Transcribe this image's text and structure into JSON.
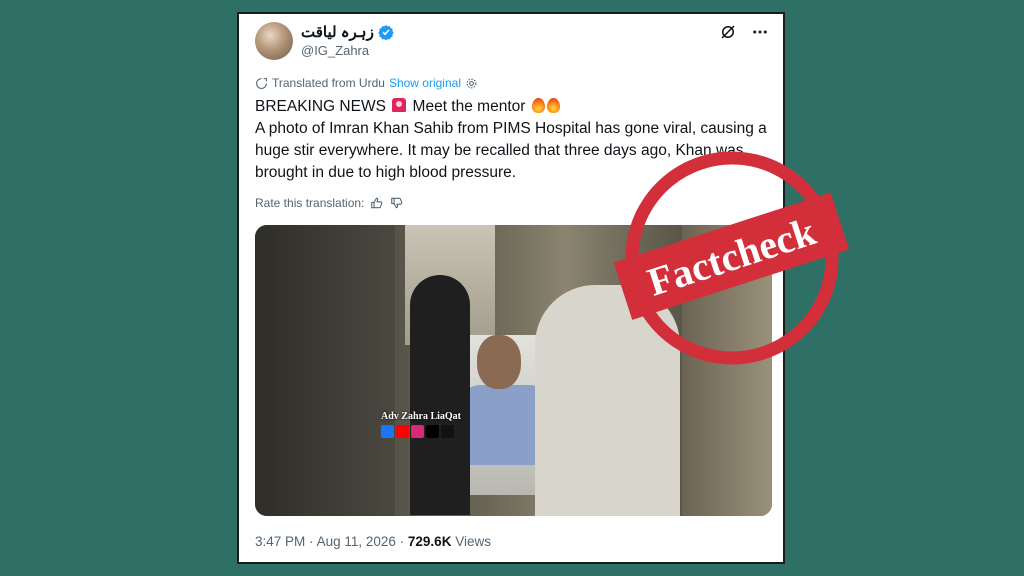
{
  "author": {
    "name": "زہرہ لیاقت",
    "handle": "@IG_Zahra"
  },
  "translation": {
    "note": "Translated from Urdu",
    "show_original": "Show original",
    "rate_label": "Rate this translation:"
  },
  "tweet": {
    "line1_a": "BREAKING NEWS",
    "line1_b": "Meet the mentor",
    "body": "A photo of Imran Khan Sahib from PIMS Hospital has gone viral, causing a huge stir everywhere. It may be recalled that three days ago, Khan was brought in due to high blood pressure."
  },
  "media": {
    "watermark": "Adv Zahra LiaQat"
  },
  "footer": {
    "time": "3:47 PM",
    "date": "Aug 11, 2026",
    "views_count": "729.6K",
    "views_label": "Views"
  },
  "stamp": {
    "text": "Factcheck"
  },
  "colors": {
    "background": "#2e7066",
    "link": "#1d9bf0",
    "stamp": "#d32f3a",
    "verified": "#1d9bf0"
  },
  "icons": [
    "verified-badge-icon",
    "grok-icon",
    "more-icon",
    "translate-icon",
    "settings-icon",
    "thumbs-up-icon",
    "thumbs-down-icon",
    "siren-emoji",
    "fire-emoji"
  ]
}
